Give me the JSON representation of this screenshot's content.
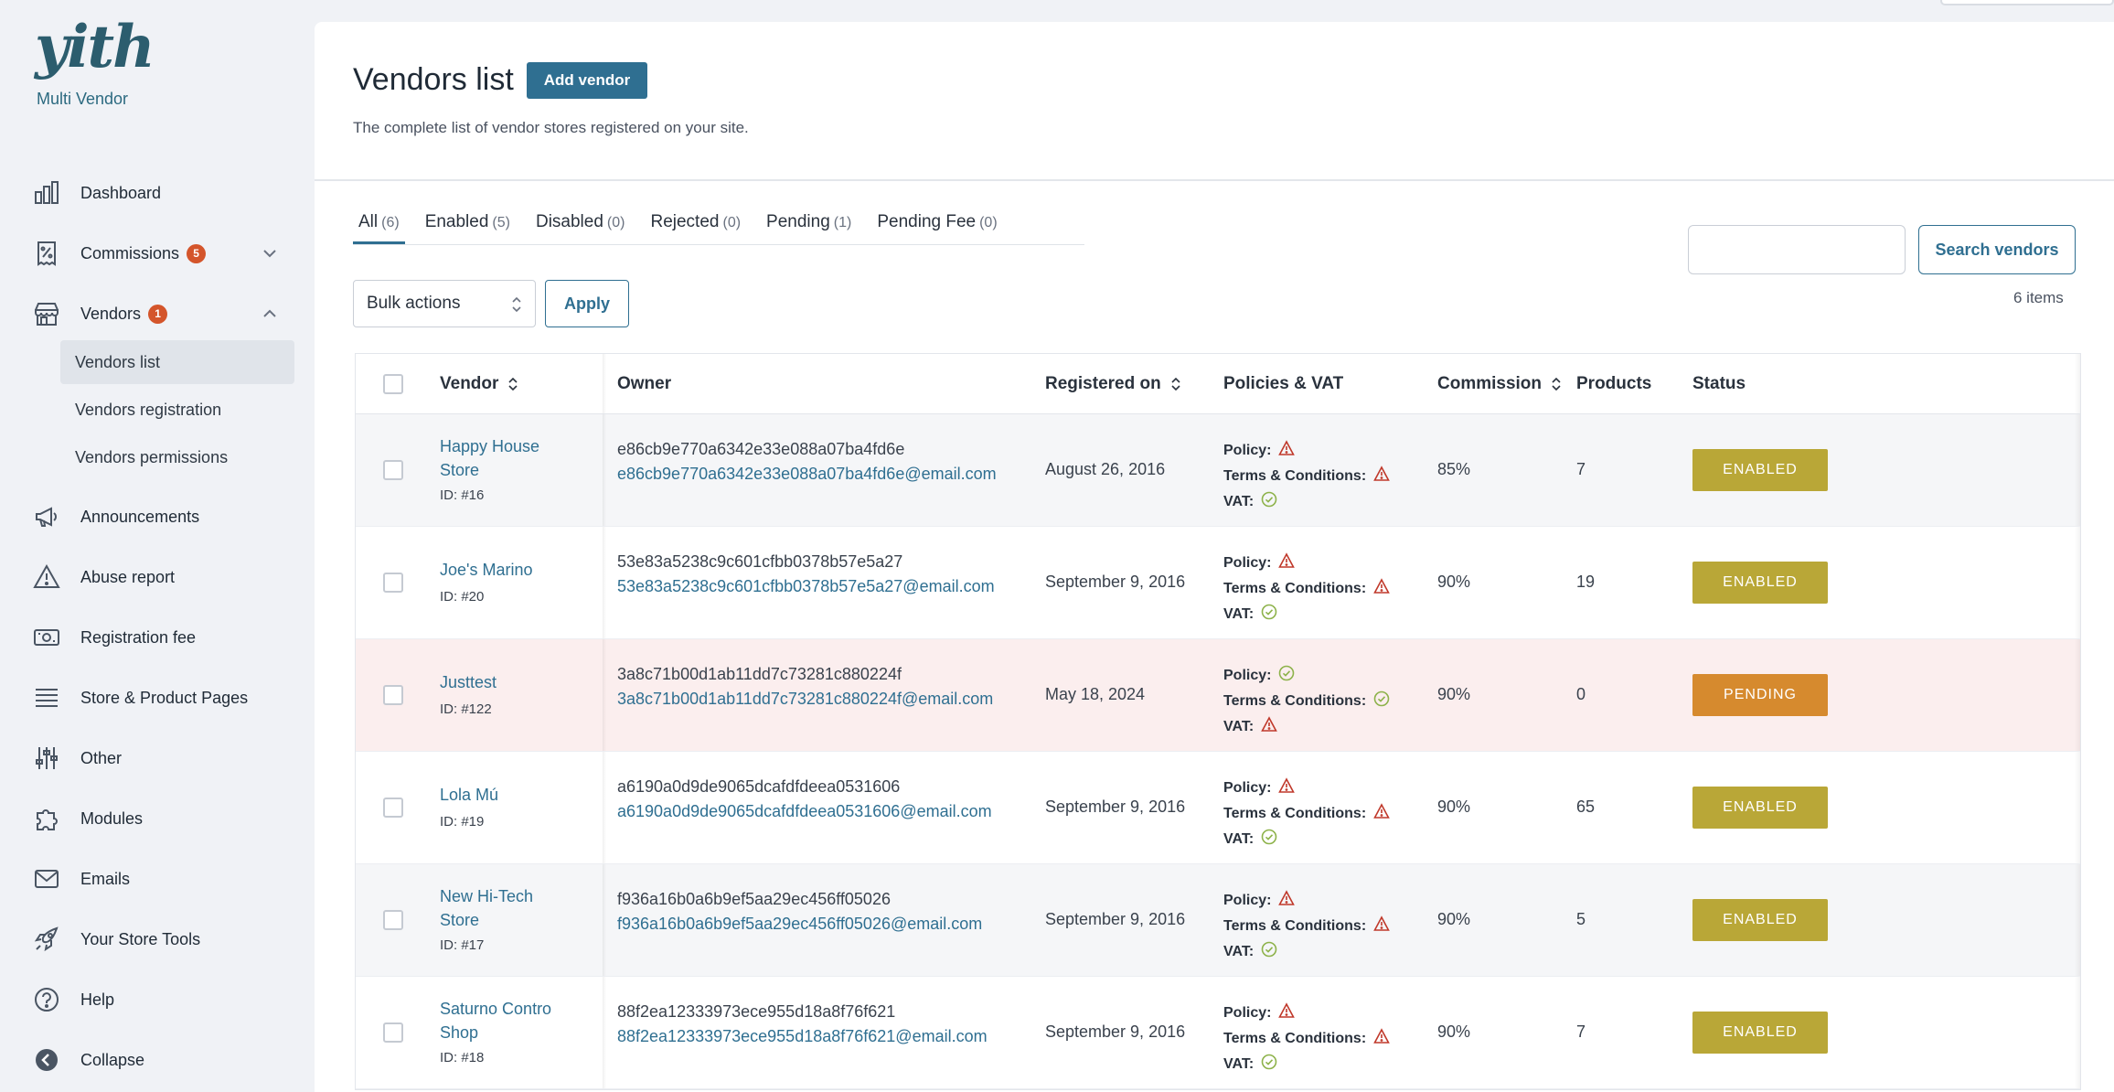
{
  "brand": {
    "logo": "yith",
    "subtitle": "Multi Vendor"
  },
  "menu": [
    {
      "label": "Dashboard",
      "icon": "bar-chart-icon"
    },
    {
      "label": "Commissions",
      "icon": "receipt-percent-icon",
      "badge": "5"
    },
    {
      "label": "Vendors",
      "icon": "store-icon",
      "badge": "1"
    },
    {
      "label": "Announcements",
      "icon": "megaphone-icon"
    },
    {
      "label": "Abuse report",
      "icon": "warning-icon"
    },
    {
      "label": "Registration fee",
      "icon": "money-icon"
    },
    {
      "label": "Store & Product Pages",
      "icon": "list-icon"
    },
    {
      "label": "Other",
      "icon": "sliders-icon"
    },
    {
      "label": "Modules",
      "icon": "puzzle-icon"
    },
    {
      "label": "Emails",
      "icon": "envelope-icon"
    },
    {
      "label": "Your Store Tools",
      "icon": "rocket-icon"
    },
    {
      "label": "Help",
      "icon": "question-icon"
    },
    {
      "label": "Collapse",
      "icon": "collapse-icon"
    }
  ],
  "vendors_submenu": [
    "Vendors list",
    "Vendors registration",
    "Vendors permissions"
  ],
  "page": {
    "title": "Vendors list",
    "add_button": "Add vendor",
    "subtitle": "The complete list of vendor stores registered on your site."
  },
  "tabs": [
    {
      "label": "All",
      "count": "(6)"
    },
    {
      "label": "Enabled",
      "count": "(5)"
    },
    {
      "label": "Disabled",
      "count": "(0)"
    },
    {
      "label": "Rejected",
      "count": "(0)"
    },
    {
      "label": "Pending",
      "count": "(1)"
    },
    {
      "label": "Pending Fee",
      "count": "(0)"
    }
  ],
  "search": {
    "button": "Search vendors",
    "placeholder": ""
  },
  "items_count": "6 items",
  "bulk": {
    "label": "Bulk actions",
    "apply": "Apply"
  },
  "columns": {
    "vendor": "Vendor",
    "owner": "Owner",
    "registered": "Registered on",
    "policies": "Policies & VAT",
    "commission": "Commission",
    "products": "Products",
    "status": "Status"
  },
  "policy_labels": {
    "policy": "Policy:",
    "terms": "Terms & Conditions:",
    "vat": "VAT:"
  },
  "colors": {
    "accent": "#2f6f91",
    "enabled": "#b9a737",
    "pending": "#d68a2e",
    "badge": "#d4552b",
    "warning": "#c0392b",
    "ok": "#8db24a"
  },
  "rows": [
    {
      "name": "Happy House Store",
      "id": "ID: #16",
      "owner": "e86cb9e770a6342e33e088a07ba4fd6e",
      "email": "e86cb9e770a6342e33e088a07ba4fd6e@email.com",
      "date": "August 26, 2016",
      "policy": "warn",
      "terms": "warn",
      "vat": "ok",
      "commission": "85%",
      "products": "7",
      "status": "ENABLED",
      "state": "enabled"
    },
    {
      "name": "Joe's Marino",
      "id": "ID: #20",
      "owner": "53e83a5238c9c601cfbb0378b57e5a27",
      "email": "53e83a5238c9c601cfbb0378b57e5a27@email.com",
      "date": "September 9, 2016",
      "policy": "warn",
      "terms": "warn",
      "vat": "ok",
      "commission": "90%",
      "products": "19",
      "status": "ENABLED",
      "state": "enabled"
    },
    {
      "name": "Justtest",
      "id": "ID: #122",
      "owner": "3a8c71b00d1ab11dd7c73281c880224f",
      "email": "3a8c71b00d1ab11dd7c73281c880224f@email.com",
      "date": "May 18, 2024",
      "policy": "ok",
      "terms": "ok",
      "vat": "warn",
      "commission": "90%",
      "products": "0",
      "status": "PENDING",
      "state": "pending"
    },
    {
      "name": "Lola Mú",
      "id": "ID: #19",
      "owner": "a6190a0d9de9065dcafdfdeea0531606",
      "email": "a6190a0d9de9065dcafdfdeea0531606@email.com",
      "date": "September 9, 2016",
      "policy": "warn",
      "terms": "warn",
      "vat": "ok",
      "commission": "90%",
      "products": "65",
      "status": "ENABLED",
      "state": "enabled"
    },
    {
      "name": "New Hi-Tech Store",
      "id": "ID: #17",
      "owner": "f936a16b0a6b9ef5aa29ec456ff05026",
      "email": "f936a16b0a6b9ef5aa29ec456ff05026@email.com",
      "date": "September 9, 2016",
      "policy": "warn",
      "terms": "warn",
      "vat": "ok",
      "commission": "90%",
      "products": "5",
      "status": "ENABLED",
      "state": "enabled"
    },
    {
      "name": "Saturno Contro Shop",
      "id": "ID: #18",
      "owner": "88f2ea12333973ece955d18a8f76f621",
      "email": "88f2ea12333973ece955d18a8f76f621@email.com",
      "date": "September 9, 2016",
      "policy": "warn",
      "terms": "warn",
      "vat": "ok",
      "commission": "90%",
      "products": "7",
      "status": "ENABLED",
      "state": "enabled"
    }
  ]
}
